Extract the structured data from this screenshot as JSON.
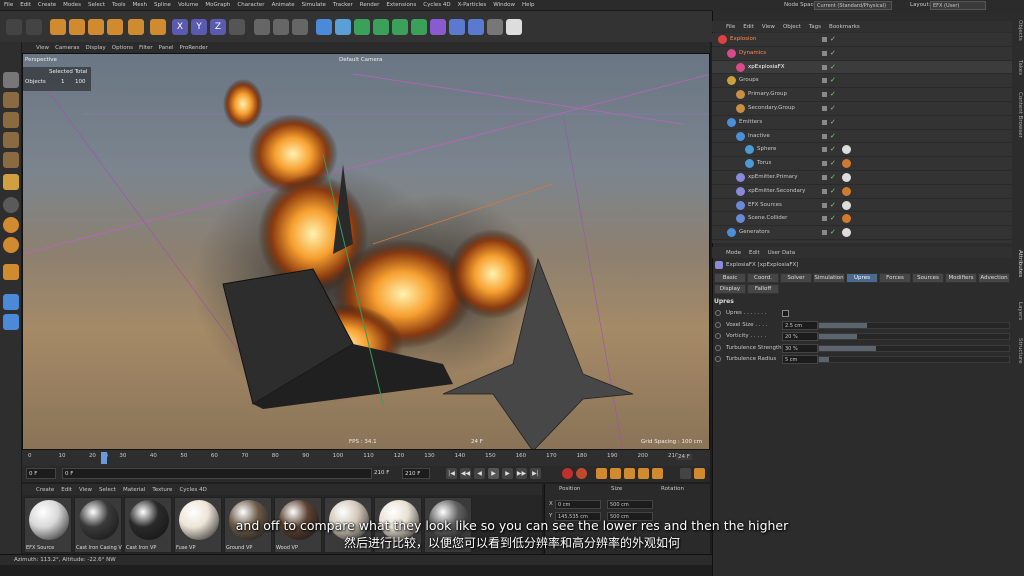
{
  "menu": [
    "File",
    "Edit",
    "Create",
    "Modes",
    "Select",
    "Tools",
    "Mesh",
    "Spline",
    "Volume",
    "MoGraph",
    "Character",
    "Animate",
    "Simulate",
    "Tracker",
    "Render",
    "Extensions",
    "Cycles 4D",
    "X-Particles",
    "Window",
    "Help"
  ],
  "node_space": {
    "label": "Node Space:",
    "value": "Current (Standard/Physical)",
    "layout_label": "Layout:",
    "layout_value": "EFX (User)"
  },
  "viewport_menu": [
    "View",
    "Cameras",
    "Display",
    "Options",
    "Filter",
    "Panel",
    "ProRender"
  ],
  "viewport": {
    "name": "Perspective",
    "camera": "Default Camera",
    "hud_header": "Selected Total",
    "hud_label": "Objects",
    "hud_selected": "1",
    "hud_total": "100",
    "fps": "FPS : 34.1",
    "frame_label": "24 F",
    "grid": "Grid Spacing : 100 cm"
  },
  "timeline": {
    "ticks": [
      "0",
      "10",
      "20",
      "24",
      "30",
      "40",
      "50",
      "60",
      "70",
      "80",
      "90",
      "100",
      "110",
      "120",
      "130",
      "140",
      "150",
      "160",
      "170",
      "180",
      "190",
      "200",
      "210"
    ],
    "current_frame": "24 F",
    "current_frame_fraction": 0.114
  },
  "transport": {
    "start": "0 F",
    "min": "0 F",
    "max": "210 F",
    "end": "210 F"
  },
  "material_menu": [
    "Create",
    "Edit",
    "View",
    "Select",
    "Material",
    "Texture",
    "Cycles 4D"
  ],
  "materials": [
    {
      "label": "EFX Source",
      "color": "#d8d8d8"
    },
    {
      "label": "Cast Iron Casing V",
      "color": "#3a3a3a"
    },
    {
      "label": "Cast Iron VP",
      "color": "#2a2a2a"
    },
    {
      "label": "Fuse VP",
      "color": "#ede4d6"
    },
    {
      "label": "Ground VP",
      "color": "#6b5a48"
    },
    {
      "label": "Wood VP",
      "color": "#5a4030"
    },
    {
      "label": "",
      "color": "#d2c8b8"
    },
    {
      "label": "",
      "color": "#e8e0d2"
    },
    {
      "label": "",
      "color": "#606060"
    }
  ],
  "coordinates": {
    "position": "Position",
    "size": "Size",
    "rotation": "Rotation",
    "x_label": "X",
    "x_pos": "0 cm",
    "x_size": "500 cm",
    "y_label": "Y",
    "y_pos": "145.535 cm",
    "y_size": "500 cm"
  },
  "status": "Azimuth: 113.2°, Altitude: -22.6° NW",
  "subtitle_en": "and off to compare what they look like so you can see the lower res and then the higher",
  "subtitle_zh": "然后进行比较，以便您可以看到低分辨率和高分辨率的外观如何",
  "object_menu": [
    "File",
    "Edit",
    "View",
    "Object",
    "Tags",
    "Bookmarks"
  ],
  "objects": [
    {
      "name": "Explosion",
      "indent": 0,
      "color": "#e04040",
      "name_color": "#ff8a4a"
    },
    {
      "name": "Dynamics",
      "indent": 1,
      "color": "#d84a8a",
      "name_color": "#ff8a4a"
    },
    {
      "name": "xpExplosiaFX",
      "indent": 2,
      "color": "#d84a8a",
      "name_color": "#ffffff"
    },
    {
      "name": "Groups",
      "indent": 1,
      "color": "#c8a040",
      "name_color": "#c8c8c8"
    },
    {
      "name": "Primary.Group",
      "indent": 2,
      "color": "#c89040",
      "name_color": "#c8c8c8"
    },
    {
      "name": "Secondary.Group",
      "indent": 2,
      "color": "#c89040",
      "name_color": "#c8c8c8"
    },
    {
      "name": "Emitters",
      "indent": 1,
      "color": "#4a90d8",
      "name_color": "#c8c8c8"
    },
    {
      "name": "Inactive",
      "indent": 2,
      "color": "#4a90d8",
      "name_color": "#c8c8c8"
    },
    {
      "name": "Sphere",
      "indent": 3,
      "color": "#4a9ad8",
      "name_color": "#c8c8c8"
    },
    {
      "name": "Torus",
      "indent": 3,
      "color": "#4a9ad8",
      "name_color": "#c8c8c8"
    },
    {
      "name": "xpEmitter.Primary",
      "indent": 2,
      "color": "#8a8ad8",
      "name_color": "#c8c8c8"
    },
    {
      "name": "xpEmitter.Secondary",
      "indent": 2,
      "color": "#8a8ad8",
      "name_color": "#c8c8c8"
    },
    {
      "name": "EFX Sources",
      "indent": 2,
      "color": "#6a8ad8",
      "name_color": "#c8c8c8"
    },
    {
      "name": "Scene.Collider",
      "indent": 2,
      "color": "#6a8ad8",
      "name_color": "#c8c8c8"
    },
    {
      "name": "Generators",
      "indent": 1,
      "color": "#4a90d8",
      "name_color": "#c8c8c8"
    }
  ],
  "attr_menu": [
    "Mode",
    "Edit",
    "User Data"
  ],
  "attr_title": "ExplosiaFX [xpExplosiaFX]",
  "tabs_row1": [
    "Basic",
    "Coord.",
    "Solver",
    "Simulation",
    "Upres",
    "Forces",
    "Sources",
    "Modifiers",
    "Advection"
  ],
  "tabs_row2": [
    "Display",
    "Falloff"
  ],
  "active_tab": "Upres",
  "section": "Upres",
  "params": [
    {
      "label": "Upres . . . . . . .",
      "value": "",
      "fill": null
    },
    {
      "label": "Voxel Size . . . .",
      "value": "2.5 cm",
      "fill": 0.25
    },
    {
      "label": "Vorticity . . . . .",
      "value": "20 %",
      "fill": 0.2
    },
    {
      "label": "Turbulence Strength",
      "value": "30 %",
      "fill": 0.3
    },
    {
      "label": "Turbulence Radius",
      "value": "5 cm",
      "fill": 0.05
    }
  ],
  "vtabs_top": [
    "Objects",
    "Takes",
    "Content Browser"
  ],
  "vtabs_bottom": [
    "Attributes",
    "Layers",
    "Structure"
  ]
}
